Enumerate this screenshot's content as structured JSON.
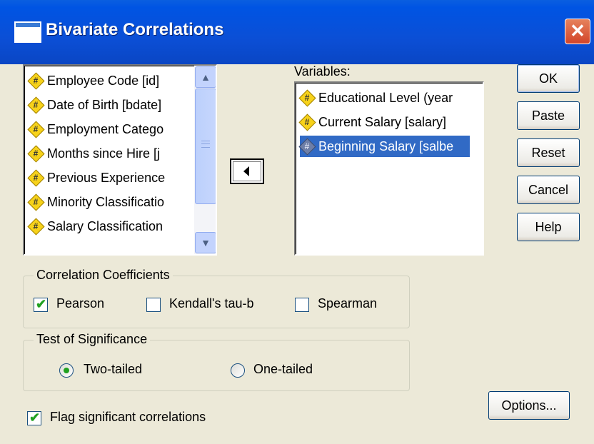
{
  "window": {
    "title": "Bivariate Correlations",
    "close_glyph": "✕"
  },
  "source_list": {
    "items": [
      "Employee Code [id]",
      "Date of Birth [bdate]",
      "Employment Catego",
      "Months since Hire [j",
      "Previous Experience",
      "Minority Classificatio",
      "Salary Classification"
    ]
  },
  "variables": {
    "label": "Variables:",
    "items": [
      "Educational Level (year",
      "Current Salary [salary]",
      "Beginning Salary [salbe"
    ],
    "selected_index": 2
  },
  "buttons": {
    "ok": "OK",
    "paste": "Paste",
    "reset": "Reset",
    "cancel": "Cancel",
    "help": "Help",
    "options": "Options..."
  },
  "coefficients": {
    "legend": "Correlation Coefficients",
    "pearson": {
      "label": "Pearson",
      "checked": true
    },
    "kendall": {
      "label": "Kendall's tau-b",
      "checked": false
    },
    "spearman": {
      "label": "Spearman",
      "checked": false
    }
  },
  "significance": {
    "legend": "Test of Significance",
    "two_tailed": {
      "label": "Two-tailed",
      "selected": true
    },
    "one_tailed": {
      "label": "One-tailed",
      "selected": false
    }
  },
  "flag": {
    "label": "Flag significant correlations",
    "checked": true
  },
  "glyphs": {
    "check": "✔",
    "scroll_up": "▲",
    "scroll_down": "▼",
    "var_icon": "#"
  },
  "colors": {
    "title_bar": "#0054e3",
    "selection": "#316ac5",
    "dialog_bg": "#ece9d8"
  }
}
